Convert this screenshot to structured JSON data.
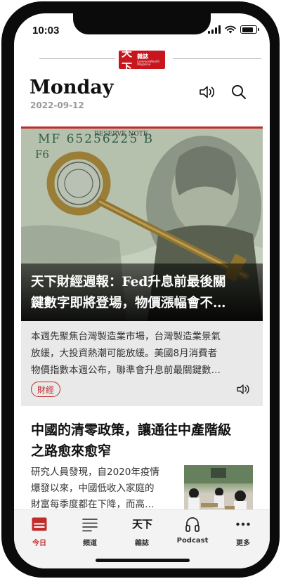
{
  "status": {
    "time": "10:03",
    "battery_level": 0.8
  },
  "brand": {
    "logo_main": "天下",
    "logo_sub": "雜誌",
    "logo_tagline": "CommonWealth Magazine"
  },
  "header": {
    "day": "Monday",
    "date": "2022-09-12",
    "listen_icon": "speaker-icon",
    "search_icon": "search-icon"
  },
  "featured": {
    "title_line1": "天下財經週報：Fed升息前最後關",
    "title_line2": "鍵數字即將登場，物價漲幅會不…",
    "summary_line1": "本週先聚焦台灣製造業市場，台灣製造業景氣",
    "summary_line2": "放緩，大投資熱潮可能放緩。美國8月消費者",
    "summary_line3": "物價指數本週公布，聯準會升息前最關鍵數…",
    "tag": "財經",
    "image": {
      "banknote_text": "MF 65256225 B",
      "banknote_text2": "F6",
      "banknote_text3": "RESERVE NOTE"
    }
  },
  "article2": {
    "title_line1": "中國的清零政策，讓通往中產階級",
    "title_line2": "之路愈來愈窄",
    "summary_line1": "研究人員發現，自2020年疫情",
    "summary_line2": "爆發以來，中國低收入家庭的",
    "summary_line3": "財富每季度都在下降，而高…"
  },
  "tabbar": {
    "items": [
      {
        "label": "今日",
        "icon": "today-icon",
        "active": true
      },
      {
        "label": "頻道",
        "icon": "channels-icon",
        "active": false
      },
      {
        "label": "雜誌",
        "icon": "magazine-icon",
        "active": false
      },
      {
        "label": "Podcast",
        "icon": "headphones-icon",
        "active": false
      },
      {
        "label": "更多",
        "icon": "more-icon",
        "active": false
      }
    ],
    "magazine_glyph": "天下"
  },
  "colors": {
    "accent": "#c22b2b",
    "logo_bg": "#c7161e",
    "text_dark": "#111111"
  }
}
